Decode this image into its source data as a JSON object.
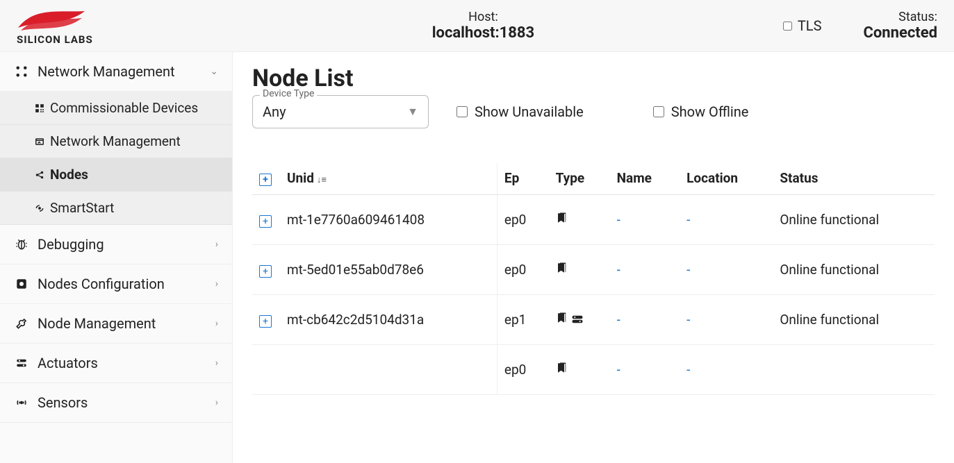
{
  "header": {
    "brand": "SILICON LABS",
    "host_label": "Host:",
    "host_value": "localhost:1883",
    "tls_label": "TLS",
    "status_label": "Status:",
    "status_value": "Connected"
  },
  "sidebar": {
    "network_management": {
      "label": "Network Management",
      "sub": {
        "commissionable": "Commissionable Devices",
        "network_mgmt": "Network Management",
        "nodes": "Nodes",
        "smartstart": "SmartStart"
      }
    },
    "debugging": "Debugging",
    "nodes_config": "Nodes Configuration",
    "node_management": "Node Management",
    "actuators": "Actuators",
    "sensors": "Sensors"
  },
  "page": {
    "title": "Node List",
    "device_type_legend": "Device Type",
    "device_type_value": "Any",
    "show_unavailable": "Show Unavailable",
    "show_offline": "Show Offline"
  },
  "table": {
    "headers": {
      "unid": "Unid",
      "ep": "Ep",
      "type": "Type",
      "name": "Name",
      "location": "Location",
      "status": "Status"
    },
    "rows": [
      {
        "unid": "mt-1e7760a609461408",
        "ep": "ep0",
        "name": "-",
        "location": "-",
        "status": "Online functional",
        "extra_icon": false
      },
      {
        "unid": "mt-5ed01e55ab0d78e6",
        "ep": "ep0",
        "name": "-",
        "location": "-",
        "status": "Online functional",
        "extra_icon": false
      },
      {
        "unid": "mt-cb642c2d5104d31a",
        "ep": "ep1",
        "name": "-",
        "location": "-",
        "status": "Online functional",
        "extra_icon": true
      },
      {
        "unid": "",
        "ep": "ep0",
        "name": "-",
        "location": "-",
        "status": "",
        "extra_icon": false
      }
    ]
  }
}
